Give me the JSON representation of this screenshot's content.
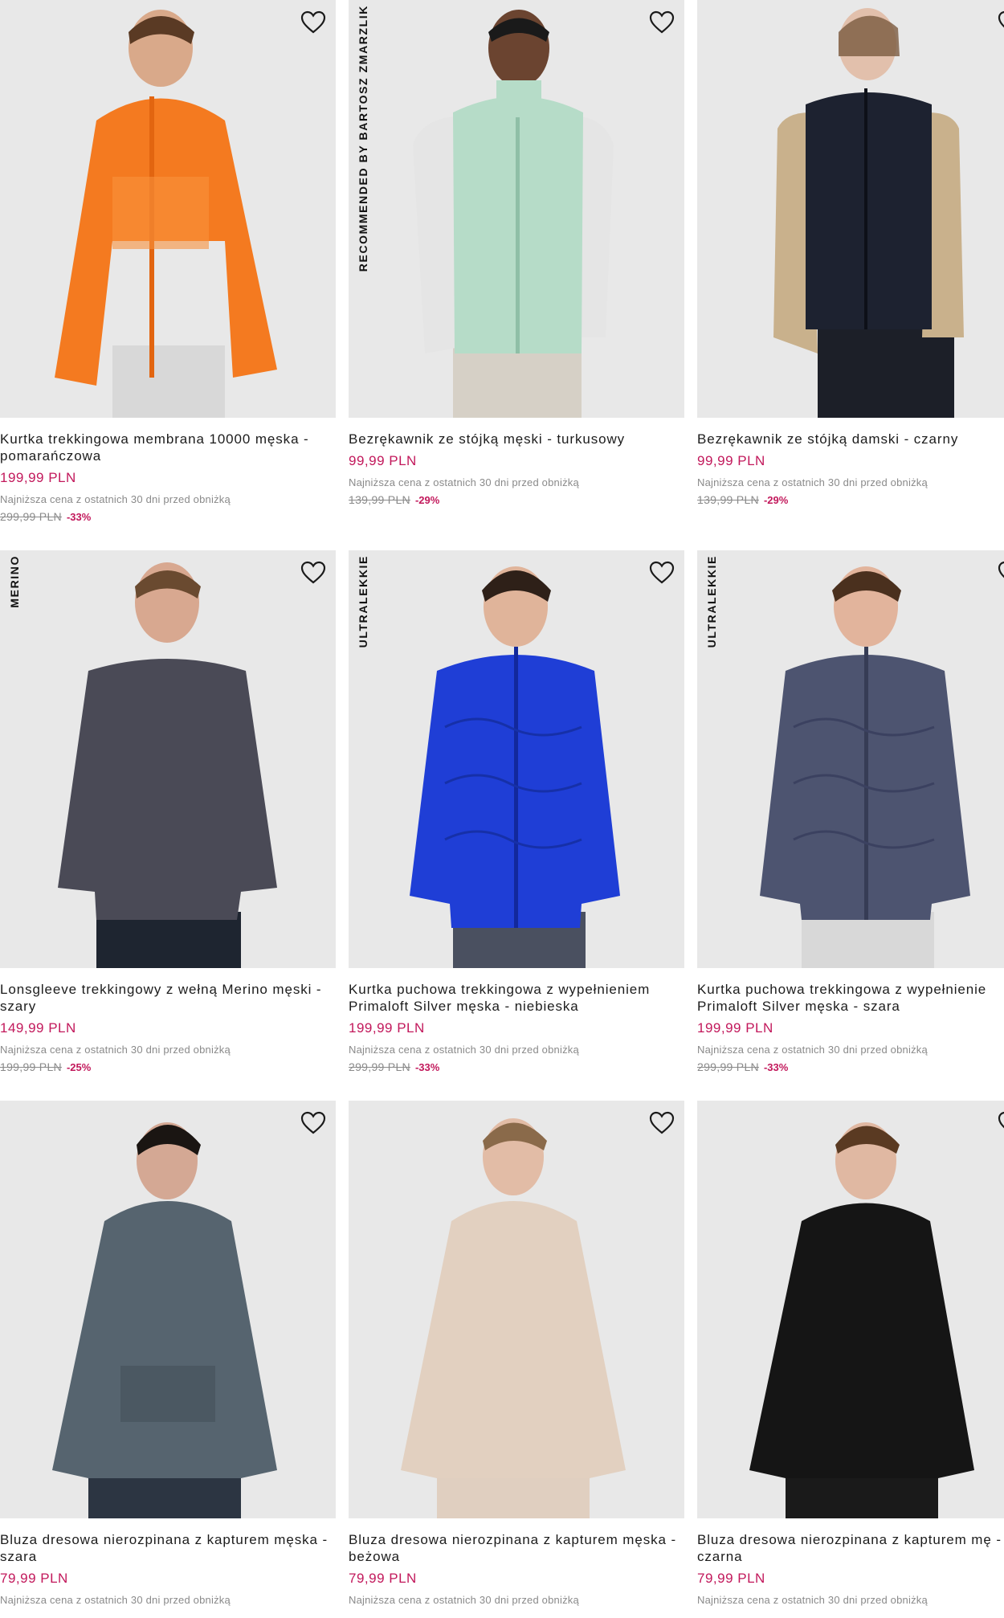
{
  "products": [
    {
      "title": "Kurtka trekkingowa membrana 10000 męska - pomarańczowa",
      "price": "199,99 PLN",
      "lowest_note": "Najniższa cena z ostatnich 30 dni przed obniżką",
      "old_price": "299,99 PLN",
      "discount": "-33%",
      "badge": "",
      "garment_color": "#f47a20",
      "icon": "heart-icon"
    },
    {
      "title": "Bezrękawnik ze stójką męski - turkusowy",
      "price": "99,99 PLN",
      "lowest_note": "Najniższa cena z ostatnich 30 dni przed obniżką",
      "old_price": "139,99 PLN",
      "discount": "-29%",
      "badge": "RECOMMENDED BY BARTOSZ ZMARZLIK",
      "garment_color": "#b6dcc8",
      "icon": "heart-icon"
    },
    {
      "title": "Bezrękawnik ze stójką damski - czarny",
      "price": "99,99 PLN",
      "lowest_note": "Najniższa cena z ostatnich 30 dni przed obniżką",
      "old_price": "139,99 PLN",
      "discount": "-29%",
      "badge": "",
      "garment_color": "#1d2230",
      "icon": "heart-icon"
    },
    {
      "title": "Lonsgleeve trekkingowy z wełną Merino męski - szary",
      "price": "149,99 PLN",
      "lowest_note": "Najniższa cena z ostatnich 30 dni przed obniżką",
      "old_price": "199,99 PLN",
      "discount": "-25%",
      "badge": "MERINO",
      "garment_color": "#4a4a56",
      "icon": "heart-icon"
    },
    {
      "title": "Kurtka puchowa trekkingowa z wypełnieniem Primaloft Silver męska - niebieska",
      "price": "199,99 PLN",
      "lowest_note": "Najniższa cena z ostatnich 30 dni przed obniżką",
      "old_price": "299,99 PLN",
      "discount": "-33%",
      "badge": "ULTRALEKKIE",
      "garment_color": "#1f3ed6",
      "icon": "heart-icon"
    },
    {
      "title": "Kurtka puchowa trekkingowa z wypełnienie Primaloft Silver męska - szara",
      "price": "199,99 PLN",
      "lowest_note": "Najniższa cena z ostatnich 30 dni przed obniżką",
      "old_price": "299,99 PLN",
      "discount": "-33%",
      "badge": "ULTRALEKKIE",
      "garment_color": "#4d5470",
      "icon": "heart-icon"
    },
    {
      "title": "Bluza dresowa nierozpinana z kapturem męska - szara",
      "price": "79,99 PLN",
      "lowest_note": "Najniższa cena z ostatnich 30 dni przed obniżką",
      "old_price": "",
      "discount": "",
      "badge": "",
      "garment_color": "#56646f",
      "icon": "heart-icon"
    },
    {
      "title": "Bluza dresowa nierozpinana z kapturem męska - beżowa",
      "price": "79,99 PLN",
      "lowest_note": "Najniższa cena z ostatnich 30 dni przed obniżką",
      "old_price": "",
      "discount": "",
      "badge": "",
      "garment_color": "#e2d0c0",
      "icon": "heart-icon"
    },
    {
      "title": "Bluza dresowa nierozpinana z kapturem mę - czarna",
      "price": "79,99 PLN",
      "lowest_note": "Najniższa cena z ostatnich 30 dni przed obniżką",
      "old_price": "",
      "discount": "",
      "badge": "",
      "garment_color": "#151515",
      "icon": "heart-icon"
    }
  ],
  "colors": {
    "accent_price": "#c2185b",
    "muted_text": "#8a8a8a",
    "photo_bg": "#e6e6e6"
  }
}
